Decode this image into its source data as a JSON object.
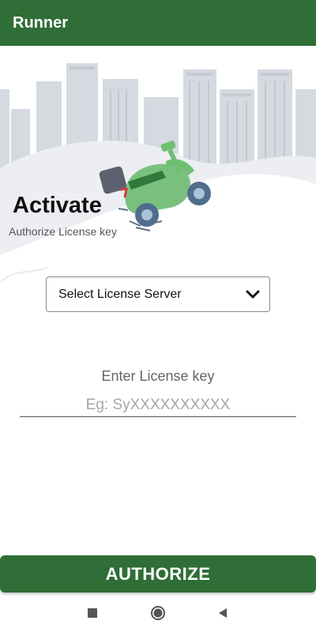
{
  "app_bar": {
    "title": "Runner"
  },
  "header": {
    "title": "Activate",
    "subtitle": "Authorize License key"
  },
  "license_server": {
    "selected": "Select License Server"
  },
  "license_key": {
    "label": "Enter License key",
    "placeholder": "Eg: SyXXXXXXXXXX",
    "value": ""
  },
  "actions": {
    "authorize_label": "AUTHORIZE"
  },
  "colors": {
    "primary": "#2f6e36",
    "illustration_green": "#6fbf73"
  },
  "icons": {
    "dropdown": "chevron-down-icon",
    "nav_recents": "square-icon",
    "nav_home": "circle-icon",
    "nav_back": "triangle-back-icon"
  }
}
